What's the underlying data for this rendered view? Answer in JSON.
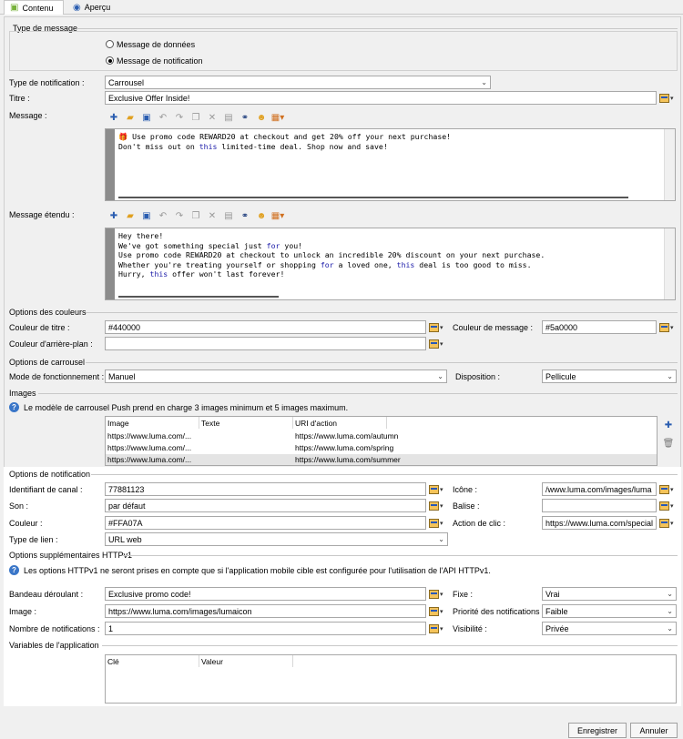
{
  "tabs": [
    {
      "label": "Contenu",
      "icon": "android-icon"
    },
    {
      "label": "Aperçu",
      "icon": "eye-icon"
    }
  ],
  "message_type": {
    "title": "Type de message",
    "options": [
      "Message de données",
      "Message de notification"
    ],
    "selected": 1
  },
  "notification_type": {
    "label": "Type de notification :",
    "value": "Carrousel"
  },
  "titre": {
    "label": "Titre :",
    "value": "Exclusive Offer Inside!"
  },
  "message": {
    "label": "Message :",
    "lines": [
      "🎁 Use promo code REWARD20 at checkout and get 20% off your next purchase!",
      "Don't miss out on this limited-time deal. Shop now and save!"
    ]
  },
  "message_etendu": {
    "label": "Message étendu :",
    "lines": [
      "Hey there!",
      "We've got something special just for you!",
      "Use promo code REWARD20 at checkout to unlock an incredible 20% discount on your next purchase.",
      "Whether you're treating yourself or shopping for a loved one, this deal is too good to miss.",
      "Hurry, this offer won't last forever!"
    ]
  },
  "couleurs": {
    "title": "Options des couleurs",
    "titre_label": "Couleur de titre :",
    "titre_value": "#440000",
    "message_label": "Couleur de message :",
    "message_value": "#5a0000",
    "fond_label": "Couleur d'arrière-plan :",
    "fond_value": ""
  },
  "carrousel": {
    "title": "Options de carrousel",
    "mode_label": "Mode de fonctionnement :",
    "mode_value": "Manuel",
    "disp_label": "Disposition :",
    "disp_value": "Pellicule"
  },
  "images": {
    "title": "Images",
    "info": "Le modèle de carrousel Push prend en charge 3 images minimum et 5 images maximum.",
    "headers": [
      "Image",
      "Texte",
      "URI d'action"
    ],
    "rows": [
      [
        "https://www.luma.com/...",
        "",
        "https://www.luma.com/autumn"
      ],
      [
        "https://www.luma.com/...",
        "",
        "https://www.luma.com/spring"
      ],
      [
        "https://www.luma.com/...",
        "",
        "https://www.luma.com/summer"
      ]
    ]
  },
  "notif": {
    "title": "Options de notification",
    "canal_label": "Identifiant de canal :",
    "canal_value": "77881123",
    "icone_label": "Icône :",
    "icone_value": "/www.luma.com/images/luma",
    "son_label": "Son :",
    "son_value": "par défaut",
    "balise_label": "Balise :",
    "balise_value": "",
    "couleur_label": "Couleur :",
    "couleur_value": "#FFA07A",
    "action_label": "Action de clic :",
    "action_value": "https://www.luma.com/special",
    "lien_label": "Type de lien :",
    "lien_value": "URL web"
  },
  "httpv1": {
    "title": "Options supplémentaires HTTPv1",
    "info": "Les options HTTPv1 ne seront prises en compte que si l'application mobile cible est configurée pour l'utilisation de l'API HTTPv1.",
    "bandeau_label": "Bandeau déroulant :",
    "bandeau_value": "Exclusive promo code!",
    "fixe_label": "Fixe :",
    "fixe_value": "Vrai",
    "image_label": "Image :",
    "image_value": "https://www.luma.com/images/lumaicon",
    "prio_label": "Priorité des notifications :",
    "prio_value": "Faible",
    "nb_label": "Nombre de notifications :",
    "nb_value": "1",
    "vis_label": "Visibilité :",
    "vis_value": "Privée"
  },
  "vars": {
    "title": "Variables de l'application",
    "headers": [
      "Clé",
      "Valeur"
    ]
  },
  "footer": {
    "save": "Enregistrer",
    "cancel": "Annuler"
  }
}
